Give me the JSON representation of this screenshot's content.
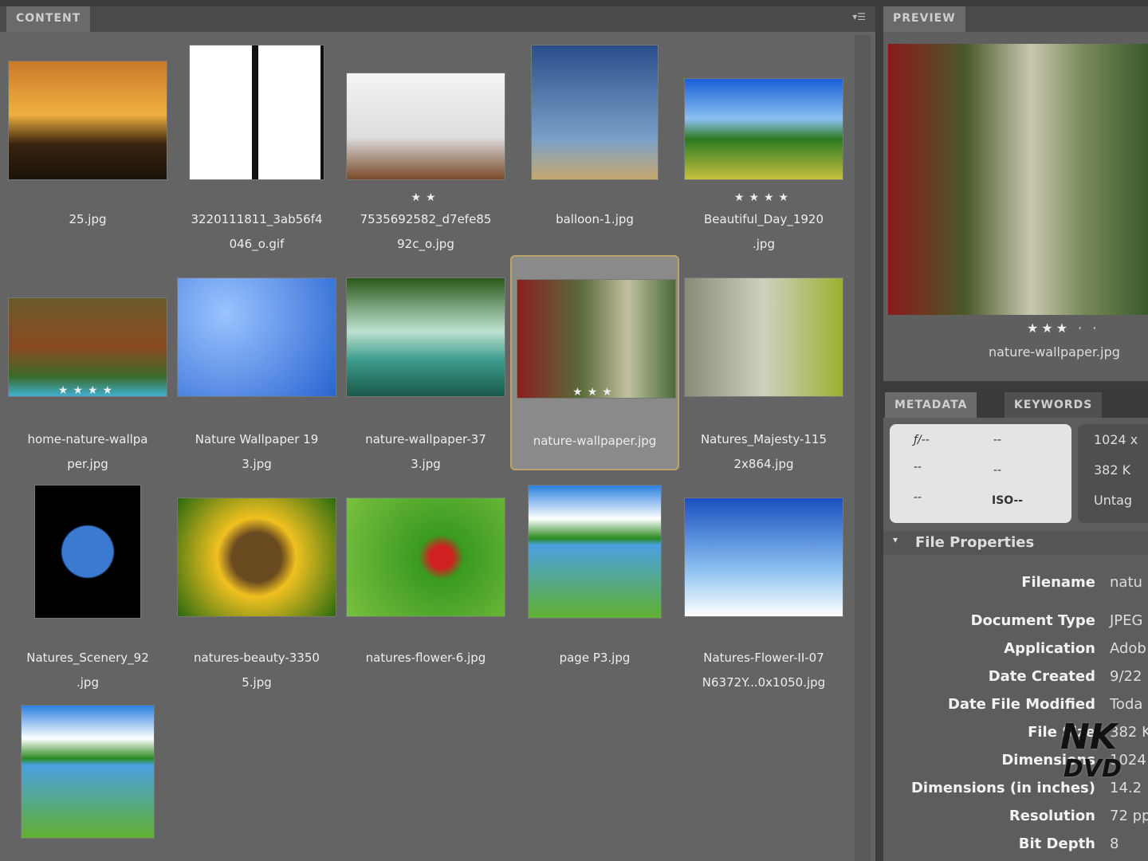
{
  "content": {
    "tab": "CONTENT",
    "items": [
      {
        "name": "25.jpg",
        "line1": "25.jpg",
        "line2": "",
        "stars": "",
        "bg": "linear-gradient(#c87a2a,#f0b040 45%,#3a2410 70%,#1a120a)"
      },
      {
        "name": "3220111811_3ab56f4046_o.gif",
        "line1": "3220111811_3ab56f4",
        "line2": "046_o.gif",
        "stars": "",
        "bg": "repeating-linear-gradient(90deg,#fff 0 78px,#111 78px 86px),#fff"
      },
      {
        "name": "7535692582_d7efe8592c_o.jpg",
        "line1": "7535692582_d7efe85",
        "line2": "92c_o.jpg",
        "stars": "★★",
        "bg": "linear-gradient(#f4f4f4,#ddd 60%,#7a4a2a)"
      },
      {
        "name": "balloon-1.jpg",
        "line1": "balloon-1.jpg",
        "line2": "",
        "stars": "",
        "bg": "linear-gradient(#2a4e8a,#7aa0c8 70%,#c8a870)"
      },
      {
        "name": "Beautiful_Day_1920.jpg",
        "line1": "Beautiful_Day_1920",
        "line2": ".jpg",
        "stars": "★★★★",
        "bg": "linear-gradient(#1a60d8,#8ac0f0 40%,#2a7a20 60%,#c8c040)"
      },
      {
        "name": "home-nature-wallpaper.jpg",
        "line1": "home-nature-wallpa",
        "line2": "per.jpg",
        "stars": "★★★★",
        "bg": "linear-gradient(#6a5a2a,#8a4a20 50%,#3a6a2a 80%,#40b0d0)"
      },
      {
        "name": "Nature Wallpaper 193.jpg",
        "line1": "Nature Wallpaper 19",
        "line2": "3.jpg",
        "stars": "",
        "bg": "radial-gradient(circle at 30% 30%,#9ac4ff,#2a64d0)"
      },
      {
        "name": "nature-wallpaper-373.jpg",
        "line1": "nature-wallpaper-37",
        "line2": "3.jpg",
        "stars": "",
        "bg": "linear-gradient(#2a5a1a,#bde0d0 45%,#3a9a8a 70%,#1a5a4a)"
      },
      {
        "name": "nature-wallpaper.jpg",
        "line1": "nature-wallpaper.jpg",
        "line2": "",
        "stars": "★★★",
        "bg": "linear-gradient(90deg,#8a2020,#5a6a3a 40%,#c0c0a0 70%,#4a6a3a)"
      },
      {
        "name": "Natures_Majesty-1152x864.jpg",
        "line1": "Natures_Majesty-115",
        "line2": "2x864.jpg",
        "stars": "",
        "bg": "linear-gradient(90deg,#8a8a7a,#d0d0c0 50%,#9ab030)"
      },
      {
        "name": "Natures_Scenery_92.jpg",
        "line1": "Natures_Scenery_92",
        "line2": ".jpg",
        "stars": "",
        "bg": "radial-gradient(circle,#3a7ad0 0 30%,#000 32%)"
      },
      {
        "name": "natures-beauty-33505.jpg",
        "line1": "natures-beauty-3350",
        "line2": "5.jpg",
        "stars": "",
        "bg": "radial-gradient(circle,#6a4a20 0 25%,#f0c020 40%,#2a6a10)"
      },
      {
        "name": "natures-flower-6.jpg",
        "line1": "natures-flower-6.jpg",
        "line2": "",
        "stars": "",
        "bg": "radial-gradient(circle at 60% 50%,#d02020 0 10%,#3a9a20 20%,#7ac040)"
      },
      {
        "name": "page P3.jpg",
        "line1": "page P3.jpg",
        "line2": "",
        "stars": "",
        "bg": "linear-gradient(#2a80e0,#fff 25%,#2a8a20 40%,#4aa0e0 45%,#60b030)"
      },
      {
        "name": "Natures-Flower-II-07N6372Y...0x1050.jpg",
        "line1": "Natures-Flower-II-07",
        "line2": "N6372Y...0x1050.jpg",
        "stars": "",
        "bg": "linear-gradient(#1a50c0,#8ac0f0 60%,#fff)"
      },
      {
        "name": "",
        "line1": "",
        "line2": "",
        "stars": "",
        "bg": "linear-gradient(#2a80e0,#fff 25%,#2a8a20 40%,#4aa0e0 45%,#60b030)"
      }
    ]
  },
  "preview": {
    "tab": "PREVIEW",
    "stars": "★★★ · ·",
    "filename": "nature-wallpaper.jpg"
  },
  "metadata": {
    "tabs": [
      "METADATA",
      "KEYWORDS"
    ],
    "camera": {
      "aperture": "ƒ/--",
      "shutter": "--",
      "c1": "--",
      "c2": "--",
      "c3": "--",
      "iso": "ISO--"
    },
    "summary": [
      "1024 x",
      "382 K",
      "Untag"
    ],
    "section": "File Properties",
    "rows": [
      {
        "k": "Filename",
        "v": "natu .jpg"
      },
      {
        "k": "Document Type",
        "v": "JPEG"
      },
      {
        "k": "Application",
        "v": "Adob"
      },
      {
        "k": "Date Created",
        "v": "9/22"
      },
      {
        "k": "Date File Modified",
        "v": "Toda"
      },
      {
        "k": "File Size",
        "v": "382 K"
      },
      {
        "k": "Dimensions",
        "v": "1024"
      },
      {
        "k": "Dimensions (in inches)",
        "v": "14.2"
      },
      {
        "k": "Resolution",
        "v": "72 pp"
      },
      {
        "k": "Bit Depth",
        "v": "8"
      }
    ]
  },
  "watermark": "NK DVD"
}
